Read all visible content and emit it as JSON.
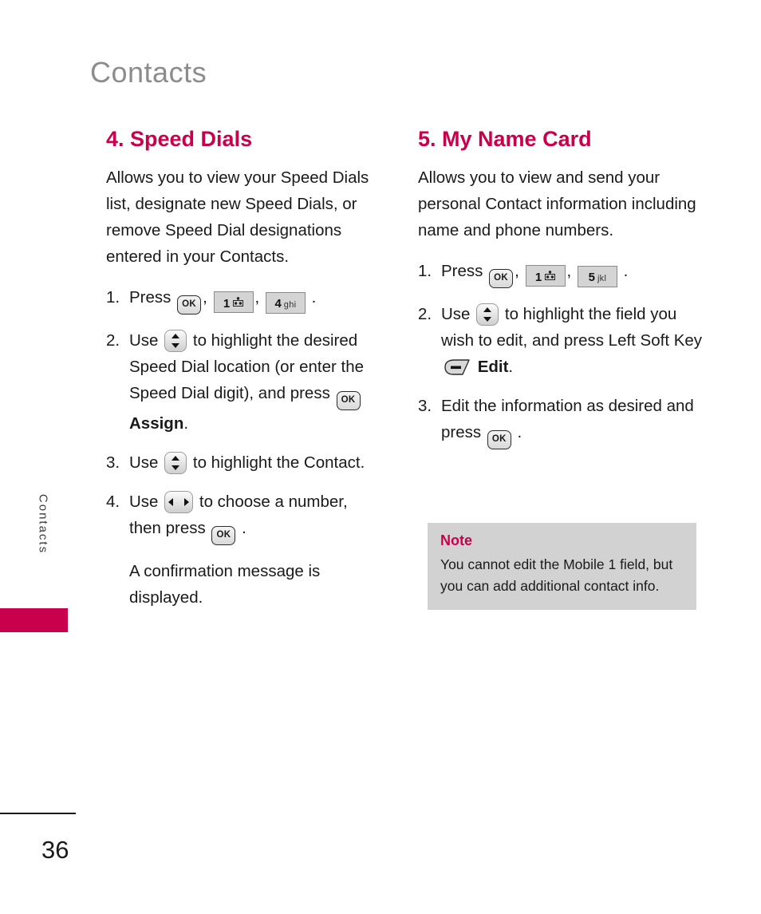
{
  "page": {
    "chapter_title": "Contacts",
    "side_tab_label": "Contacts",
    "page_number": "36",
    "accent_color": "#c9004b",
    "chapter_title_color": "#8c8c8c",
    "note_background_color": "#d2d2d2"
  },
  "left_column": {
    "heading": "4. Speed Dials",
    "intro": "Allows you to view your Speed Dials list, designate new Speed Dials, or remove Speed Dial designations entered in your Contacts.",
    "steps": [
      {
        "number": "1.",
        "text_before": "Press",
        "keys": [
          "ok-key",
          "1-key",
          "4-key"
        ],
        "key_labels": {
          "one": "1",
          "one_letters": "",
          "four": "4",
          "four_letters": "ghi"
        },
        "text_after": "."
      },
      {
        "number": "2.",
        "text_before": "Use",
        "key": "up-down-nav-key",
        "text_middle": "to highlight the desired Speed Dial location (or enter the Speed Dial digit), and press",
        "key2": "ok-key",
        "bold_label": "Assign",
        "text_after": "."
      },
      {
        "number": "3.",
        "text_before": "Use",
        "key": "up-down-nav-key",
        "text_after": "to highlight the Contact."
      },
      {
        "number": "4.",
        "text_before": "Use",
        "key": "left-right-nav-key",
        "text_middle": "to choose a number, then press",
        "key2": "ok-key",
        "text_after": "."
      }
    ],
    "closing_note": "A confirmation message is displayed."
  },
  "right_column": {
    "heading": "5. My Name Card",
    "intro": "Allows you to view and send your personal Contact information including name and phone numbers.",
    "steps": [
      {
        "number": "1.",
        "text_before": "Press",
        "keys": [
          "ok-key",
          "1-key",
          "5-key"
        ],
        "key_labels": {
          "one": "1",
          "five": "5",
          "five_letters": "jkl"
        },
        "text_after": "."
      },
      {
        "number": "2.",
        "text_before": "Use",
        "key": "up-down-nav-key",
        "text_middle": "to highlight the field you wish to edit, and press Left Soft Key",
        "key2": "left-soft-key",
        "bold_label": "Edit",
        "text_after": "."
      },
      {
        "number": "3.",
        "text_before": "Edit the information as desired and press",
        "key": "ok-key",
        "text_after": "."
      }
    ],
    "note": {
      "title": "Note",
      "body": "You cannot edit the Mobile 1 field, but you can add additional contact info."
    }
  },
  "key_glyphs": {
    "ok_label": "OK"
  }
}
